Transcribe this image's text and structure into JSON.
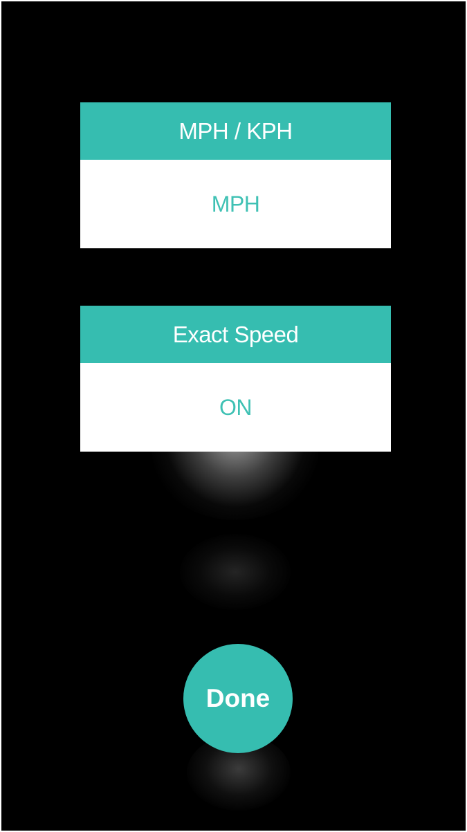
{
  "settings": {
    "units": {
      "title": "MPH / KPH",
      "value": "MPH"
    },
    "exact_speed": {
      "title": "Exact Speed",
      "value": "ON"
    }
  },
  "done_button": {
    "label": "Done"
  },
  "colors": {
    "accent": "#36bdb0",
    "background": "#000000",
    "card_body": "#ffffff",
    "value_text": "#3fc1b4"
  }
}
